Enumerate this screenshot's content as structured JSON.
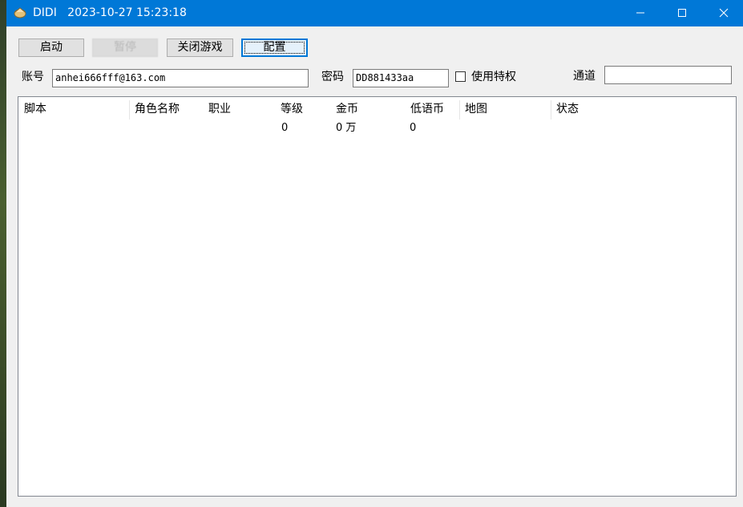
{
  "window": {
    "title": "DIDI   2023-10-27 15:23:18"
  },
  "toolbar": {
    "start_label": "启动",
    "disabled_label": "暂停",
    "close_game_label": "关闭游戏",
    "config_label": "配置"
  },
  "form": {
    "account_label": "账号",
    "account_value": "anhei666fff@163.com",
    "password_label": "密码",
    "password_value": "DD881433aa",
    "privilege_label": "使用特权",
    "privilege_checked": false,
    "channel_label": "通道",
    "channel_value": ""
  },
  "table": {
    "columns": [
      "脚本",
      "角色名称",
      "职业",
      "等级",
      "金币",
      "低语币",
      "地图",
      "状态"
    ],
    "rows": [
      {
        "script": "",
        "role_name": "",
        "job": "",
        "level": "0",
        "gold": "0 万",
        "whisper_coin": "0",
        "map": "",
        "status": ""
      }
    ]
  },
  "colors": {
    "titlebar": "#0078d7",
    "window_bg": "#f0f0f0",
    "focus_border": "#0078d7"
  }
}
